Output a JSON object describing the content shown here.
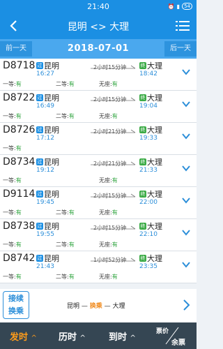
{
  "status_bar": {
    "time": "21:40",
    "icons": [
      "alarm-icon",
      "signal-icon",
      "battery-icon"
    ],
    "battery": "54"
  },
  "header": {
    "title": "昆明 <> 大理"
  },
  "date_bar": {
    "prev": "前一天",
    "date": "2018-07-01",
    "next": "后一天"
  },
  "trains": [
    {
      "no": "D8718",
      "dep_badge": "过",
      "dep": "昆明",
      "dep_time": "16:27",
      "duration": "2小时15分钟",
      "arr_badge": "终",
      "arr": "大理",
      "arr_time": "18:42",
      "seats": [
        [
          "一等:",
          "有"
        ],
        [
          "二等:",
          "有"
        ],
        [
          "无座:",
          "有"
        ]
      ]
    },
    {
      "no": "D8722",
      "dep_badge": "过",
      "dep": "昆明",
      "dep_time": "16:49",
      "duration": "2小时15分钟",
      "arr_badge": "终",
      "arr": "大理",
      "arr_time": "19:04",
      "seats": [
        [
          "一等:",
          "有"
        ],
        [
          "二等:",
          "有"
        ],
        [
          "无座:",
          "有"
        ]
      ]
    },
    {
      "no": "D8726",
      "dep_badge": "过",
      "dep": "昆明",
      "dep_time": "17:12",
      "duration": "2小时21分钟",
      "arr_badge": "终",
      "arr": "大理",
      "arr_time": "19:33",
      "seats": [
        [
          "一等:",
          "有"
        ],
        [
          "",
          ""
        ],
        [
          "",
          ""
        ]
      ]
    },
    {
      "no": "D8734",
      "dep_badge": "过",
      "dep": "昆明",
      "dep_time": "19:12",
      "duration": "2小时21分钟",
      "arr_badge": "终",
      "arr": "大理",
      "arr_time": "21:33",
      "seats": [
        [
          "一等:",
          "有"
        ],
        [
          "",
          ""
        ],
        [
          "无座:",
          "有"
        ]
      ]
    },
    {
      "no": "D9114",
      "dep_badge": "过",
      "dep": "昆明",
      "dep_time": "19:45",
      "duration": "2小时15分钟",
      "arr_badge": "终",
      "arr": "大理",
      "arr_time": "22:00",
      "seats": [
        [
          "一等:",
          "有"
        ],
        [
          "二等:",
          "有"
        ],
        [
          "无座:",
          "有"
        ]
      ]
    },
    {
      "no": "D8738",
      "dep_badge": "过",
      "dep": "昆明",
      "dep_time": "19:55",
      "duration": "2小时15分钟",
      "arr_badge": "终",
      "arr": "大理",
      "arr_time": "22:10",
      "seats": [
        [
          "一等:",
          "有"
        ],
        [
          "二等:",
          "有"
        ],
        [
          "无座:",
          "有"
        ]
      ]
    },
    {
      "no": "D8742",
      "dep_badge": "过",
      "dep": "昆明",
      "dep_time": "21:43",
      "duration": "1小时52分钟",
      "arr_badge": "终",
      "arr": "大理",
      "arr_time": "23:35",
      "seats": [
        [
          "一等:",
          "有"
        ],
        [
          "二等:",
          "有"
        ],
        [
          "无座:",
          "有"
        ]
      ]
    }
  ],
  "transfer": {
    "btn_line1": "接续",
    "btn_line2": "换乘",
    "from": "昆明",
    "sep1": " — ",
    "via": "换乘",
    "sep2": " — ",
    "to": "大理"
  },
  "bottom_bar": {
    "depart": "发时",
    "duration": "历时",
    "arrive": "到时",
    "price": "票价",
    "remaining": "余票",
    "sort_icon": "^"
  },
  "colors": {
    "primary": "#1b8fe3",
    "accent": "#f08a1c",
    "available": "#2aa13a",
    "bottom": "#354653"
  }
}
